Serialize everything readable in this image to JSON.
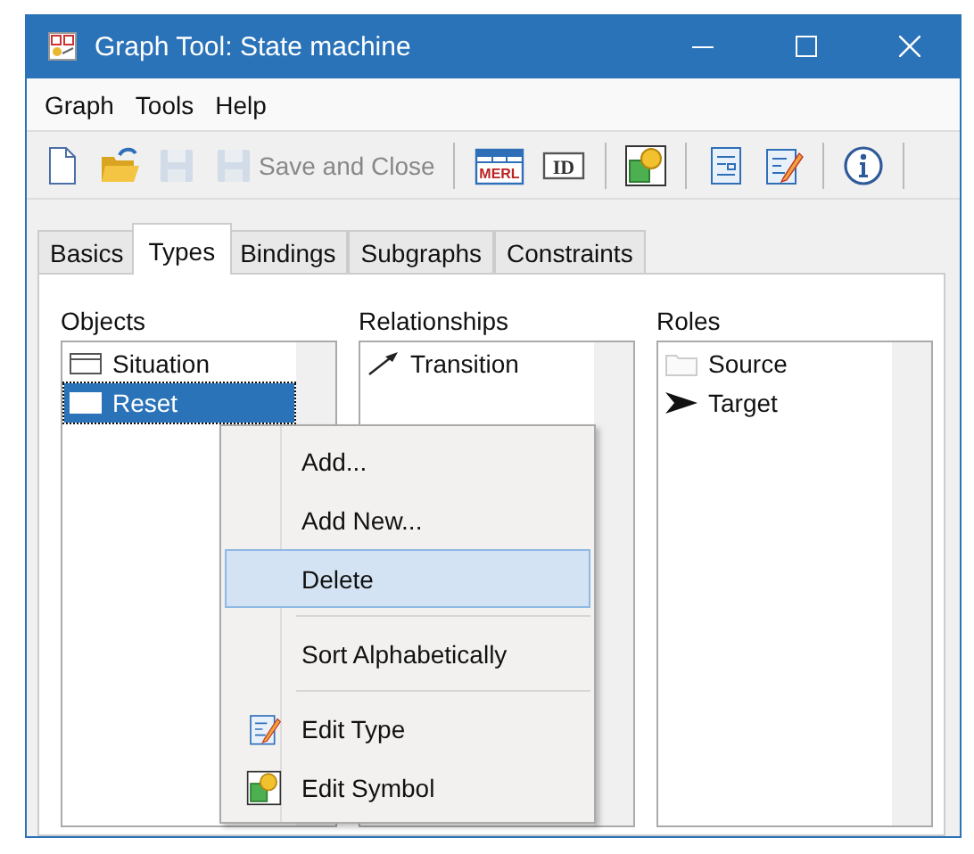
{
  "window": {
    "title": "Graph Tool: State machine"
  },
  "menu": [
    "Graph",
    "Tools",
    "Help"
  ],
  "toolbar": [
    {
      "kind": "icon",
      "disabled": false
    },
    {
      "kind": "icon",
      "disabled": false
    },
    {
      "kind": "icon",
      "disabled": true
    },
    {
      "kind": "button",
      "label": "Save and Close",
      "disabled": true
    },
    {
      "kind": "separator"
    },
    {
      "kind": "icon",
      "label": "MERL",
      "disabled": false
    },
    {
      "kind": "icon",
      "label": "ID",
      "disabled": false
    },
    {
      "kind": "separator"
    },
    {
      "kind": "icon",
      "disabled": false
    },
    {
      "kind": "separator"
    },
    {
      "kind": "icon",
      "disabled": false
    },
    {
      "kind": "icon",
      "disabled": false
    },
    {
      "kind": "separator"
    },
    {
      "kind": "icon",
      "disabled": false
    },
    {
      "kind": "separator"
    }
  ],
  "tabs": [
    {
      "label": "Basics",
      "selected": false
    },
    {
      "label": "Types",
      "selected": true
    },
    {
      "label": "Bindings",
      "selected": false
    },
    {
      "label": "Subgraphs",
      "selected": false
    },
    {
      "label": "Constraints",
      "selected": false
    }
  ],
  "lists": [
    {
      "title": "Objects",
      "items": [
        {
          "label": "Situation",
          "selected": false
        },
        {
          "label": "Reset",
          "selected": true
        }
      ]
    },
    {
      "title": "Relationships",
      "items": [
        {
          "label": "Transition",
          "selected": false
        }
      ]
    },
    {
      "title": "Roles",
      "items": [
        {
          "label": "Source",
          "selected": false
        },
        {
          "label": "Target",
          "selected": false
        }
      ]
    }
  ],
  "context_menu": [
    {
      "kind": "item",
      "label": "Add...",
      "selected": false
    },
    {
      "kind": "item",
      "label": "Add New...",
      "selected": false
    },
    {
      "kind": "item",
      "label": "Delete",
      "selected": true
    },
    {
      "kind": "separator"
    },
    {
      "kind": "item",
      "label": "Sort Alphabetically",
      "selected": false
    },
    {
      "kind": "separator"
    },
    {
      "kind": "item",
      "label": "Edit Type",
      "selected": false
    },
    {
      "kind": "item",
      "label": "Edit Symbol",
      "selected": false
    }
  ]
}
